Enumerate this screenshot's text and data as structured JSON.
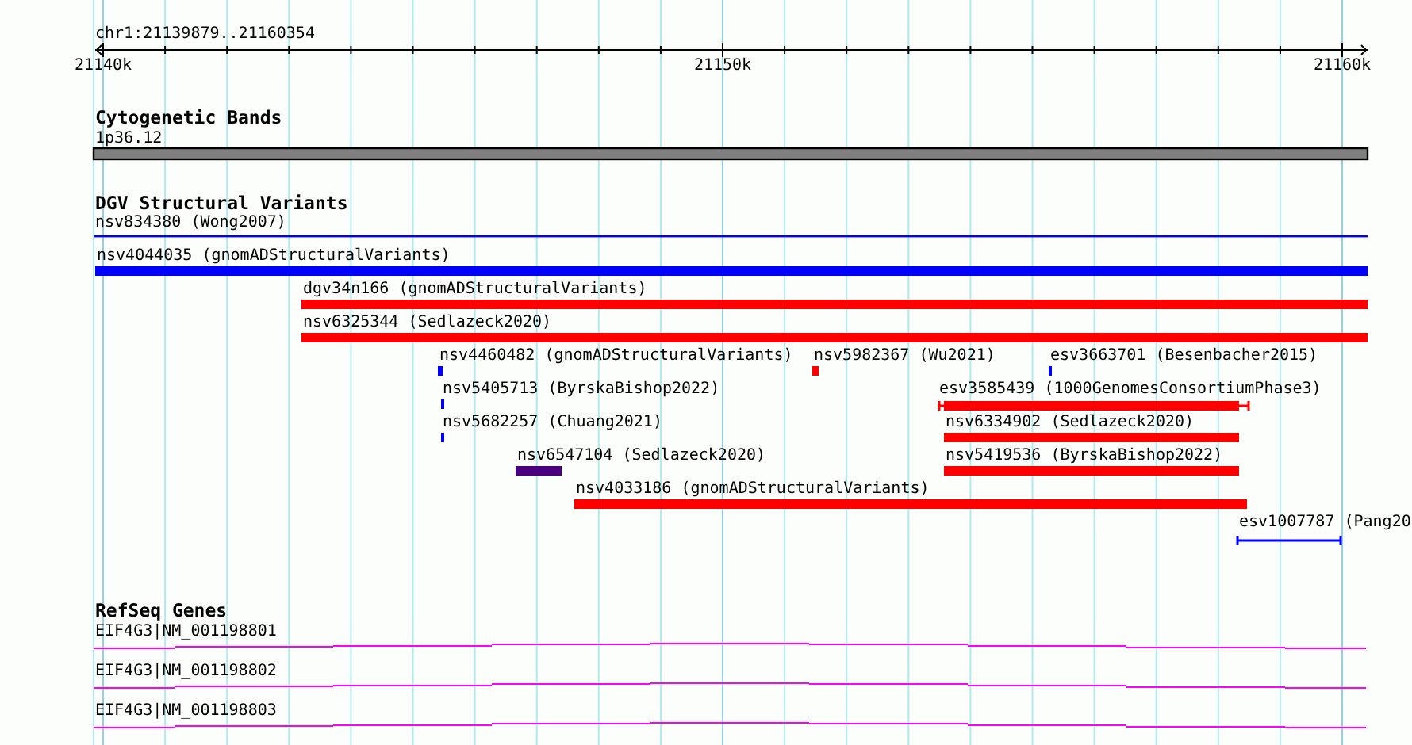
{
  "location": "chr1:21139879..21160354",
  "ruler": {
    "ticks": [
      "21140k",
      "21150k",
      "21160k"
    ]
  },
  "tracks": [
    {
      "kind": "bands",
      "title": "Cytogenetic Bands",
      "features": [
        {
          "label": "1p36.12"
        }
      ]
    },
    {
      "kind": "variants",
      "title": "DGV Structural Variants",
      "features": [
        {
          "kind": "line",
          "label": "nsv834380 (Wong2007)",
          "color": "#0000ff"
        },
        {
          "kind": "bar",
          "label": "nsv4044035 (gnomADStructuralVariants)",
          "color": "#0000ff"
        },
        {
          "kind": "bar",
          "label": "dgv34n166 (gnomADStructuralVariants)",
          "color": "#ff0000"
        },
        {
          "kind": "bar",
          "label": "nsv6325344 (Sedlazeck2020)",
          "color": "#ff0000"
        },
        {
          "kind": "bar",
          "label": "nsv4460482 (gnomADStructuralVariants)",
          "color": "#0000ff"
        },
        {
          "kind": "bar",
          "label": "nsv5982367 (Wu2021)",
          "color": "#ff0000"
        },
        {
          "kind": "bar",
          "label": "esv3663701 (Besenbacher2015)",
          "color": "#0000ff"
        },
        {
          "kind": "bar",
          "label": "nsv5405713 (ByrskaBishop2022)",
          "color": "#0000ff"
        },
        {
          "kind": "whiskers",
          "label": "esv3585439 (1000GenomesConsortiumPhase3)",
          "color": "#ff0000"
        },
        {
          "kind": "bar",
          "label": "nsv5682257 (Chuang2021)",
          "color": "#0000ff"
        },
        {
          "kind": "bar",
          "label": "nsv6334902 (Sedlazeck2020)",
          "color": "#ff0000"
        },
        {
          "kind": "bar",
          "label": "nsv6547104 (Sedlazeck2020)",
          "color": "#4b0082"
        },
        {
          "kind": "bar",
          "label": "nsv5419536 (ByrskaBishop2022)",
          "color": "#ff0000"
        },
        {
          "kind": "bar",
          "label": "nsv4033186 (gnomADStructuralVariants)",
          "color": "#ff0000"
        },
        {
          "kind": "span",
          "label": "esv1007787 (Pang20",
          "color": "#0000ff"
        }
      ]
    },
    {
      "kind": "genes",
      "title": "RefSeq Genes",
      "features": [
        {
          "label": "EIF4G3|NM_001198801"
        },
        {
          "label": "EIF4G3|NM_001198802"
        },
        {
          "label": "EIF4G3|NM_001198803"
        }
      ]
    }
  ]
}
